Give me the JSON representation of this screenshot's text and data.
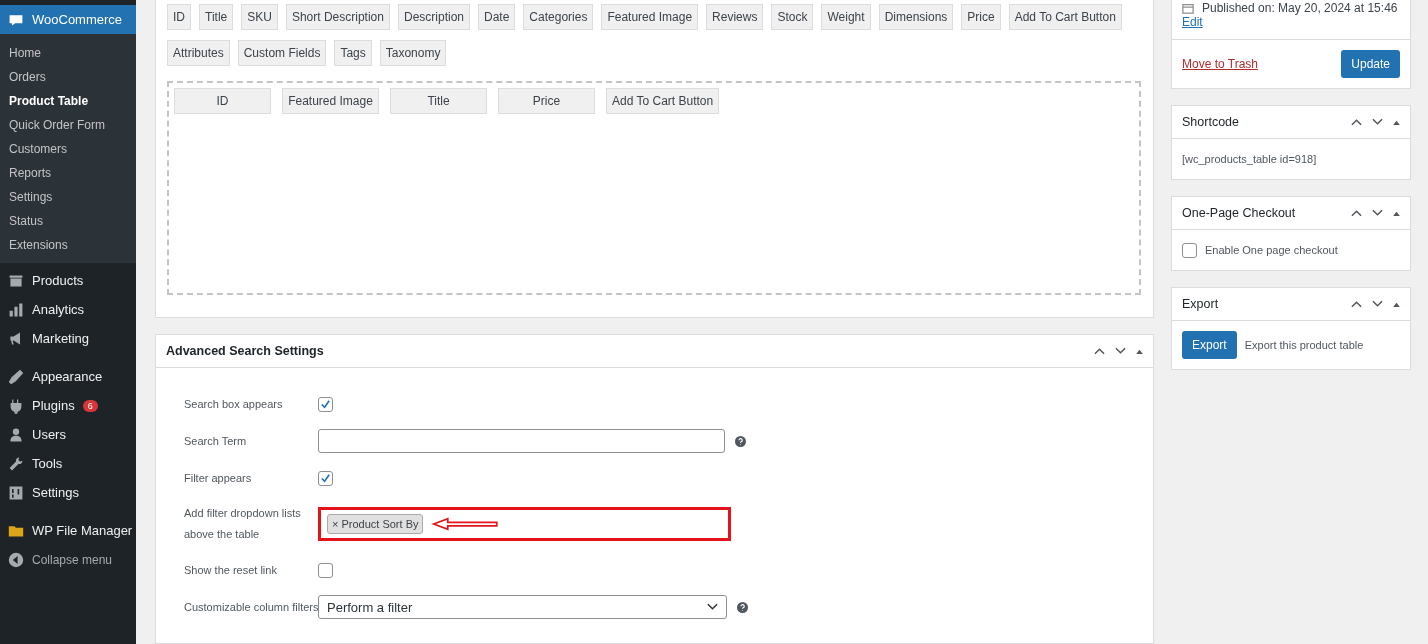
{
  "sidebar": {
    "items": [
      {
        "label": "WooCommerce",
        "selected": true,
        "children": [
          {
            "label": "Home",
            "selected": false
          },
          {
            "label": "Orders",
            "selected": false
          },
          {
            "label": "Product Table",
            "selected": true
          },
          {
            "label": "Quick Order Form",
            "selected": false
          },
          {
            "label": "Customers",
            "selected": false
          },
          {
            "label": "Reports",
            "selected": false
          },
          {
            "label": "Settings",
            "selected": false
          },
          {
            "label": "Status",
            "selected": false
          },
          {
            "label": "Extensions",
            "selected": false
          }
        ]
      },
      {
        "label": "Products",
        "selected": false
      },
      {
        "label": "Analytics",
        "selected": false
      },
      {
        "label": "Marketing",
        "selected": false
      },
      {
        "label": "Appearance",
        "selected": false
      },
      {
        "label": "Plugins",
        "selected": false,
        "badge": "6"
      },
      {
        "label": "Users",
        "selected": false
      },
      {
        "label": "Tools",
        "selected": false
      },
      {
        "label": "Settings",
        "selected": false
      },
      {
        "label": "WP File Manager",
        "selected": false
      },
      {
        "label": "Collapse menu",
        "selected": false
      }
    ]
  },
  "table_columns": {
    "available_fields": [
      "ID",
      "Title",
      "SKU",
      "Short Description",
      "Description",
      "Date",
      "Categories",
      "Featured Image",
      "Reviews",
      "Stock",
      "Weight",
      "Dimensions",
      "Price",
      "Add To Cart Button",
      "Attributes",
      "Custom Fields",
      "Tags",
      "Taxonomy"
    ],
    "selected_fields": [
      "ID",
      "Featured Image",
      "Title",
      "Price",
      "Add To Cart Button"
    ]
  },
  "advanced_search": {
    "title": "Advanced Search Settings",
    "rows": [
      {
        "kind": "checkbox",
        "label": "Search box appears",
        "checked": true
      },
      {
        "kind": "text",
        "label": "Search Term",
        "value": "",
        "help": true
      },
      {
        "kind": "checkbox",
        "label": "Filter appears",
        "checked": true
      },
      {
        "kind": "tags",
        "label": "Add filter dropdown lists above the table",
        "tags": [
          {
            "remove": "×",
            "label": "Product Sort By"
          }
        ],
        "highlighted": true
      },
      {
        "kind": "checkbox",
        "label": "Show the reset link",
        "checked": false
      },
      {
        "kind": "select",
        "label": "Customizable column filters",
        "value": "Perform a filter",
        "help": true
      }
    ]
  },
  "publish": {
    "published": "Published on: May 20, 2024 at 15:46",
    "edit_link": "Edit",
    "trash_link": "Move to Trash",
    "update_button": "Update"
  },
  "shortcode": {
    "title": "Shortcode",
    "text": "[wc_products_table id=918]"
  },
  "checkout": {
    "title": "One-Page Checkout",
    "label": "Enable One page checkout",
    "checked": false
  },
  "export": {
    "title": "Export",
    "button": "Export",
    "text": "Export this product table"
  }
}
